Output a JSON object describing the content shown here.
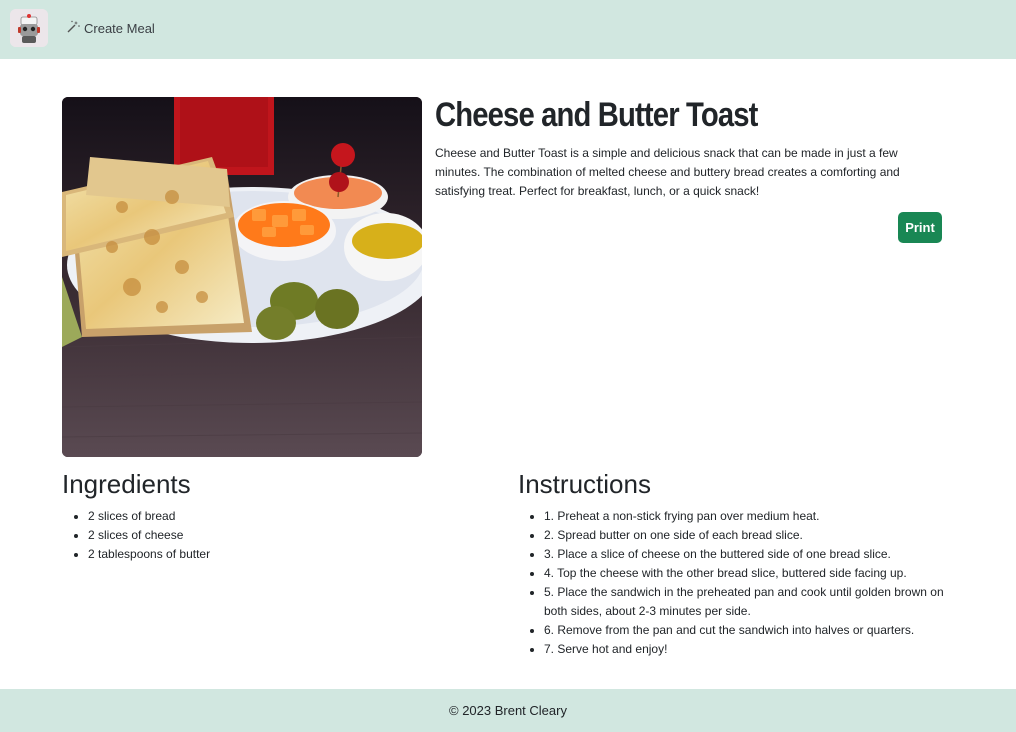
{
  "navbar": {
    "logo_icon": "robot-chef-icon",
    "create_meal_icon": "magic-wand-icon",
    "create_meal_label": "Create Meal"
  },
  "recipe": {
    "title": "Cheese and Butter Toast",
    "description": "Cheese and Butter Toast is a simple and delicious snack that can be made in just a few minutes. The combination of melted cheese and buttery bread creates a comforting and satisfying treat. Perfect for breakfast, lunch, or a quick snack!",
    "print_label": "Print"
  },
  "ingredients": {
    "heading": "Ingredients",
    "items": [
      "2 slices of bread",
      "2 slices of cheese",
      "2 tablespoons of butter"
    ]
  },
  "instructions": {
    "heading": "Instructions",
    "items": [
      "1. Preheat a non-stick frying pan over medium heat.",
      "2. Spread butter on one side of each bread slice.",
      "3. Place a slice of cheese on the buttered side of one bread slice.",
      "4. Top the cheese with the other bread slice, buttered side facing up.",
      "5. Place the sandwich in the preheated pan and cook until golden brown on both sides, about 2-3 minutes per side.",
      "6. Remove from the pan and cut the sandwich into halves or quarters.",
      "7. Serve hot and enjoy!"
    ]
  },
  "footer": {
    "copyright": "© 2023 Brent Cleary"
  },
  "colors": {
    "navbar_bg": "#d1e7e0",
    "print_button": "#198754"
  }
}
